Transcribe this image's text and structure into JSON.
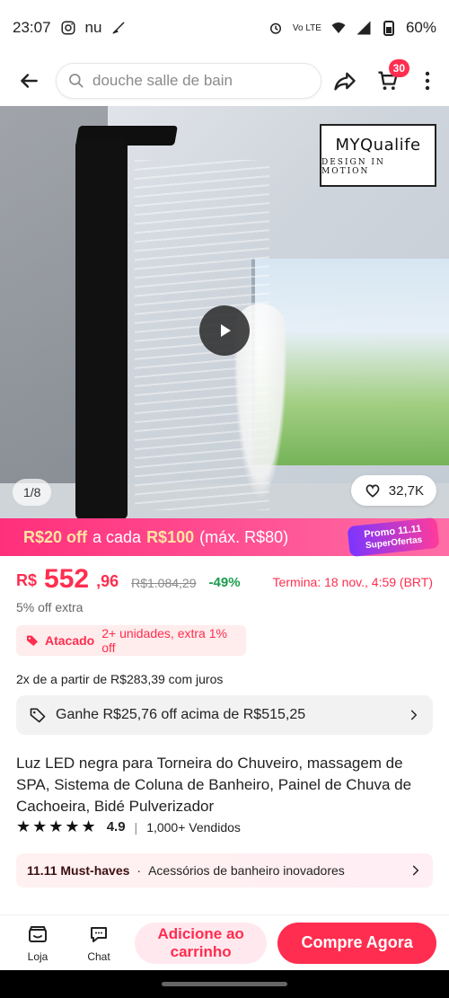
{
  "status": {
    "time": "23:07",
    "carrier_icon_text": "nu",
    "network": "Vo LTE",
    "battery": "60%"
  },
  "search": {
    "placeholder": "douche salle de bain"
  },
  "header": {
    "cart_count": "30"
  },
  "media": {
    "brand_name": "MYQualife",
    "brand_tagline": "DESIGN IN MOTION",
    "image_counter": "1/8",
    "likes": "32,7K"
  },
  "promo": {
    "off_amount": "R$20 off",
    "text_mid": "a cada",
    "min_amount": "R$100",
    "max": "(máx. R$80)",
    "badge_line1": "Promo 11.11",
    "badge_line2": "SuperOfertas"
  },
  "price": {
    "currency": "R$",
    "integer": "552",
    "decimal": ",96",
    "original": "R$1.084,29",
    "discount": "-49%",
    "ends_label": "Termina:",
    "ends_time": "18 nov., 4:59 (BRT)",
    "extra": "5% off extra"
  },
  "wholesale": {
    "label": "Atacado",
    "text": "2+ unidades, extra 1% off"
  },
  "installments": "2x de a partir de R$283,39 com juros",
  "coupon": {
    "text": "Ganhe R$25,76 off acima de R$515,25"
  },
  "product": {
    "title": "Luz LED negra para Torneira do Chuveiro, massagem de SPA, Sistema de Coluna de Banheiro, Painel de Chuva de Cachoeira, Bidé Pulverizador",
    "rating": "4.9",
    "sold": "1,000+ Vendidos",
    "stars": "★★★★★"
  },
  "must_haves": {
    "title": "11.11 Must-haves",
    "text": "Acessórios de banheiro inovadores"
  },
  "bottom": {
    "store_label": "Loja",
    "chat_label": "Chat",
    "add_to_cart": "Adicione ao carrinho",
    "buy_now": "Compre Agora"
  },
  "colors": {
    "accent": "#ff2d4f",
    "promo_gradient_start": "#ff2f7b",
    "promo_gradient_end": "#ff6da7",
    "discount_green": "#1b9c4c"
  },
  "icons": {
    "back": "arrow-left-icon",
    "search": "search-icon",
    "share": "share-icon",
    "cart": "cart-icon",
    "more": "more-vert-icon",
    "play": "play-icon",
    "heart": "heart-icon",
    "tag": "tag-icon",
    "chevron": "chevron-right-icon",
    "store": "store-icon",
    "chat": "chat-icon"
  }
}
